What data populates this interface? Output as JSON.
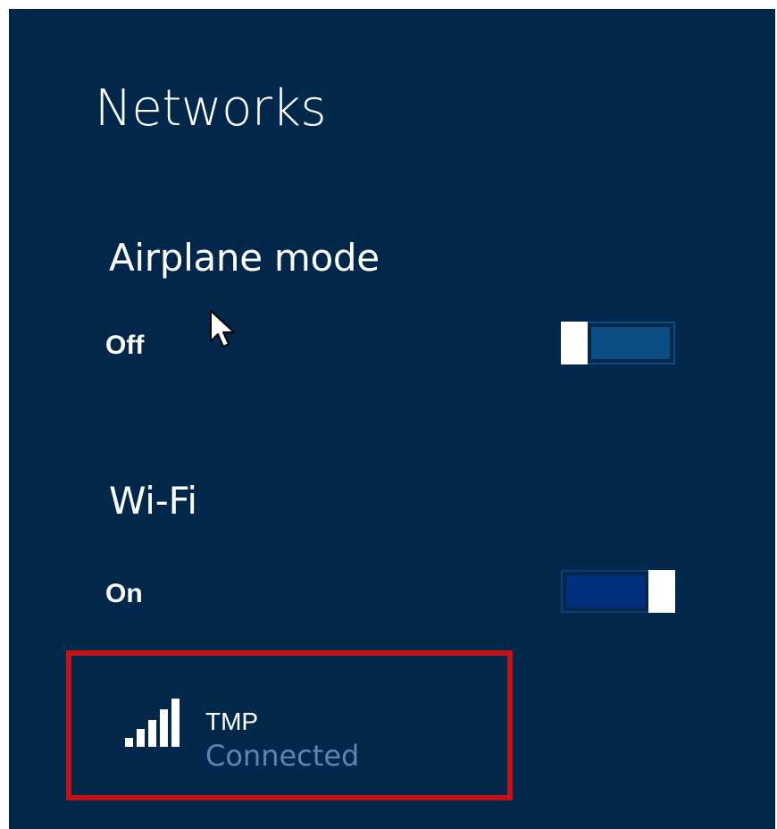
{
  "panel": {
    "title": "Networks",
    "background_color": "#01284a"
  },
  "airplane_mode": {
    "label": "Airplane mode",
    "state_label": "Off",
    "enabled": false
  },
  "wifi": {
    "label": "Wi-Fi",
    "state_label": "On",
    "enabled": true
  },
  "networks": [
    {
      "name": "TMP",
      "status": "Connected",
      "icon": "signal-strength-icon",
      "signal_bars": 5,
      "highlighted": true,
      "highlight_color": "#c1121a"
    }
  ],
  "colors": {
    "toggle_off_track": "#0b4e86",
    "toggle_on_track": "#03307e",
    "status_text": "#5b86b3"
  }
}
